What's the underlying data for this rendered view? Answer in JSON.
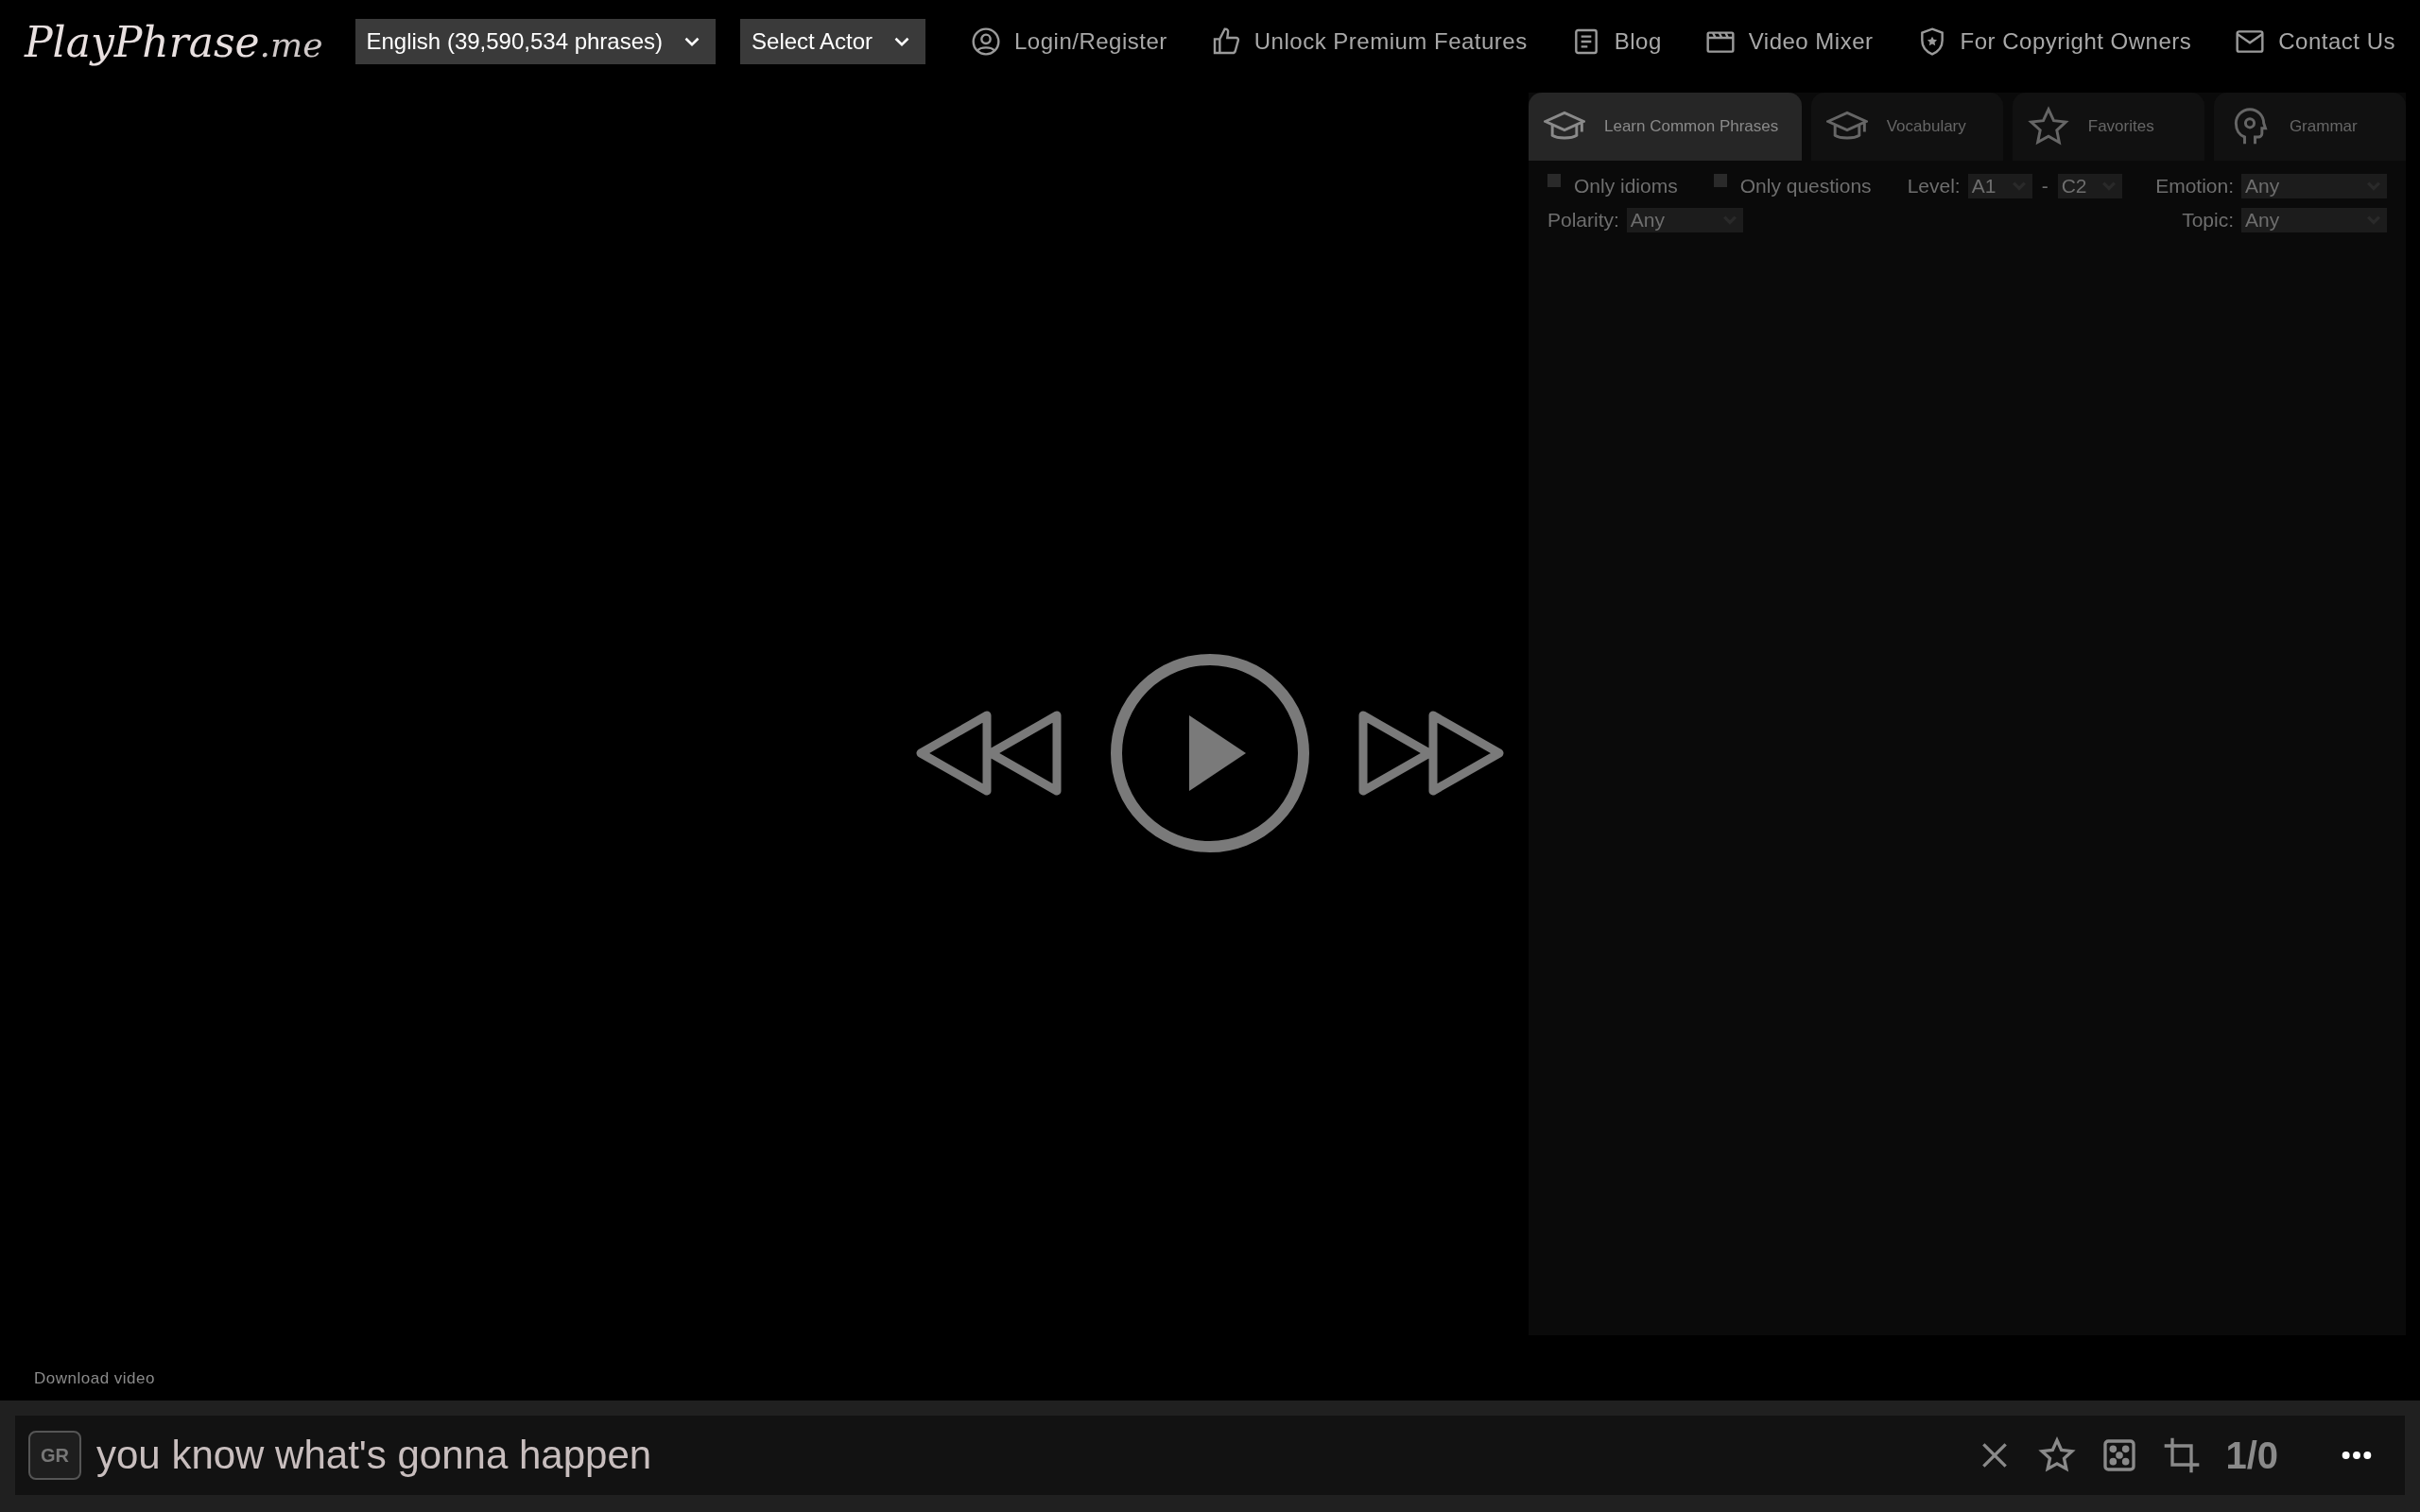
{
  "header": {
    "logo": {
      "main": "PlayPhrase",
      "suffix": ".me"
    },
    "selects": [
      {
        "label": "English (39,590,534 phrases)"
      },
      {
        "label": "Select Actor"
      }
    ],
    "nav": [
      {
        "kind": "user",
        "label": "Login/Register"
      },
      {
        "kind": "thumb",
        "label": "Unlock Premium Features"
      },
      {
        "kind": "doc",
        "label": "Blog"
      },
      {
        "kind": "clapper",
        "label": "Video Mixer"
      },
      {
        "kind": "shield",
        "label": "For Copyright Owners"
      },
      {
        "kind": "mail",
        "label": "Contact Us"
      }
    ]
  },
  "panel": {
    "tabs": [
      {
        "kind": "cap",
        "label": "Learn Common Phrases",
        "selected": true
      },
      {
        "kind": "cap",
        "label": "Vocabulary",
        "selected": false
      },
      {
        "kind": "star",
        "label": "Favorites",
        "selected": false
      },
      {
        "kind": "head",
        "label": "Grammar",
        "selected": false
      }
    ],
    "checkboxes": [
      {
        "label": "Only idioms",
        "checked": false
      },
      {
        "label": "Only questions",
        "checked": false
      }
    ],
    "level": {
      "label": "Level:",
      "from": "A1",
      "separator": "-",
      "to": "C2"
    },
    "emotion": {
      "label": "Emotion:",
      "value": "Any"
    },
    "polarity": {
      "label": "Polarity:",
      "value": "Any"
    },
    "topic": {
      "label": "Topic:",
      "value": "Any"
    }
  },
  "download_link": "Download video",
  "phrase_bar": {
    "badge": "GR",
    "phrase": "you know what's gonna happen",
    "counter": "1/0"
  }
}
